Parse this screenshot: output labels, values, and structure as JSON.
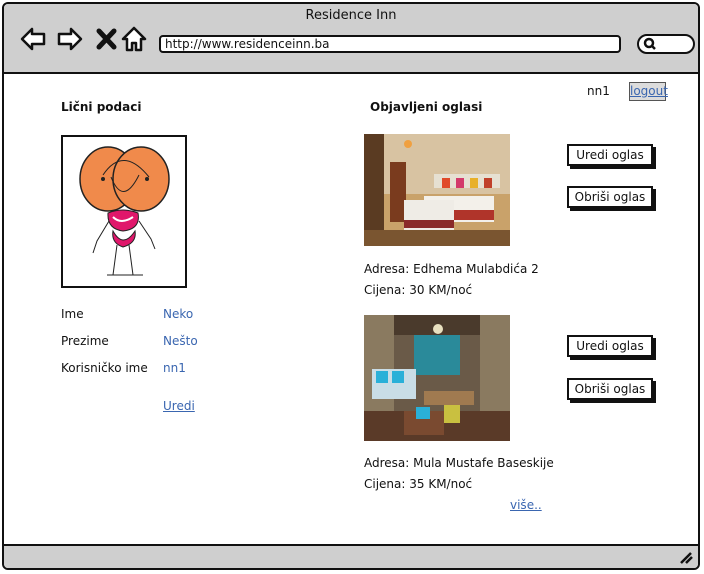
{
  "window": {
    "title": "Residence Inn"
  },
  "browser": {
    "url": "http://www.residenceinn.ba",
    "icons": [
      "back-icon",
      "forward-icon",
      "stop-icon",
      "home-icon",
      "search-icon"
    ]
  },
  "header": {
    "username": "nn1",
    "logout_label": "logout"
  },
  "profile": {
    "heading": "Lični podaci",
    "fields": [
      {
        "label": "Ime",
        "value": "Neko"
      },
      {
        "label": "Prezime",
        "value": "Nešto"
      },
      {
        "label": "Korisničko ime",
        "value": "nn1"
      }
    ],
    "edit_label": "Uredi"
  },
  "listings": {
    "heading": "Objavljeni oglasi",
    "items": [
      {
        "address": "Adresa: Edhema Mulabdića 2",
        "price": "Cijena: 30 KM/noć",
        "edit_label": "Uredi oglas",
        "delete_label": "Obriši oglas"
      },
      {
        "address": "Adresa: Mula Mustafe Baseskije",
        "price": "Cijena: 35 KM/noć",
        "edit_label": "Uredi oglas",
        "delete_label": "Obriši oglas"
      }
    ],
    "more_label": "više.."
  },
  "colors": {
    "link": "#3a66b0",
    "chrome": "#cfcfcf",
    "border": "#111111"
  }
}
